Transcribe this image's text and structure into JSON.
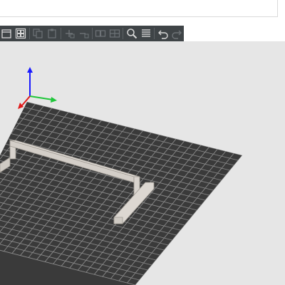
{
  "window": {
    "address_bar_value": ""
  },
  "toolbar": {
    "buttons": [
      {
        "name": "delete-all-icon",
        "enabled": true
      },
      {
        "name": "arrange-icon",
        "enabled": true
      },
      {
        "name": "copy-icon",
        "enabled": false
      },
      {
        "name": "paste-icon",
        "enabled": false
      },
      {
        "name": "add-instance-icon",
        "enabled": false
      },
      {
        "name": "remove-instance-icon",
        "enabled": false
      },
      {
        "name": "split-objects-icon",
        "enabled": false
      },
      {
        "name": "split-parts-icon",
        "enabled": false
      },
      {
        "name": "search-icon",
        "enabled": true
      },
      {
        "name": "layer-editing-icon",
        "enabled": true
      },
      {
        "name": "undo-icon",
        "enabled": true
      },
      {
        "name": "redo-icon",
        "enabled": false
      }
    ],
    "colors": {
      "background": "#3f4447",
      "icon_enabled": "#d9d9d9",
      "icon_disabled": "#6e7377"
    }
  },
  "viewport": {
    "background_color": "#e6e6e6",
    "bed_color": "#3a3a3a",
    "grid_color": "#8a8a8a",
    "model_color": "#d8d3cd",
    "axes": {
      "x_color": "#e01b1b",
      "y_color": "#1fc63a",
      "z_color": "#1a1aff"
    },
    "model_name": "bar-model"
  }
}
